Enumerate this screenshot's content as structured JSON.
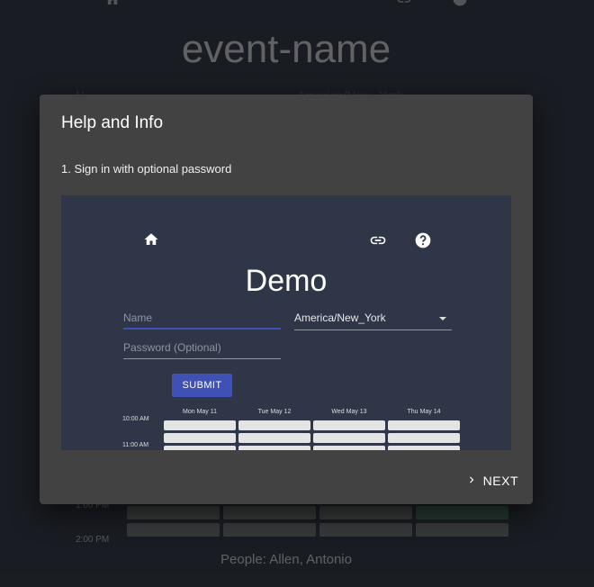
{
  "background": {
    "title": "event-name",
    "name_faint": "N",
    "timezone_faint": "America/New_York",
    "times": [
      "1:00 PM",
      "2:00 PM"
    ],
    "people": "People: Allen, Antonio"
  },
  "dialog": {
    "title": "Help and Info",
    "step": "1. Sign in with optional password",
    "next_label": "NEXT",
    "demo": {
      "title": "Demo",
      "name_placeholder": "Name",
      "password_placeholder": "Password (Optional)",
      "timezone": "America/New_York",
      "submit_label": "SUBMIT",
      "days": [
        "Mon May 11",
        "Tue May 12",
        "Wed May 13",
        "Thu May 14"
      ],
      "times": [
        "10:00 AM",
        "11:00 AM"
      ]
    }
  },
  "icons": {
    "bg": [
      "home-icon",
      "link-icon",
      "help-icon"
    ],
    "demo": [
      "home-icon",
      "link-icon",
      "help-icon"
    ],
    "next": "chevron-right-icon"
  },
  "colors": {
    "accent": "#3f51b5",
    "dialog_bg": "#424242",
    "page_bg": "#1d2027"
  }
}
